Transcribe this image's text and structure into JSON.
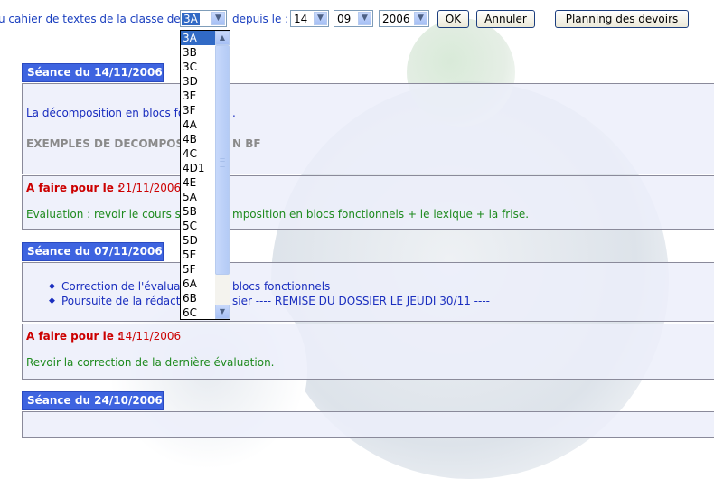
{
  "toolbar": {
    "intro_text": "u cahier de textes de la classe de",
    "class_value": "3A",
    "since_label": "depuis le :",
    "day_value": "14",
    "month_value": "09",
    "year_value": "2006",
    "ok_label": "OK",
    "cancel_label": "Annuler",
    "planning_label": "Planning des devoirs"
  },
  "dropdown": {
    "options": [
      "3A",
      "3B",
      "3C",
      "3D",
      "3E",
      "3F",
      "4A",
      "4B",
      "4C",
      "4D1",
      "4E",
      "5A",
      "5B",
      "5C",
      "5D",
      "5E",
      "5F",
      "6A",
      "6B",
      "6C"
    ],
    "selected": "3A"
  },
  "sessions": [
    {
      "title": "Séance du 14/11/2006",
      "line1": "La décomposition en blocs fo",
      "line1_tail": ".",
      "line2": "EXEMPLES DE DECOMPOS",
      "line2_tail": "N BF",
      "todo_label": "A faire pour le :",
      "todo_date": "21/11/2006",
      "todo_text_a": "Evaluation : revoir le cours su",
      "todo_text_b": "mposition en blocs fonctionnels + le lexique + la frise."
    },
    {
      "title": "Séance du 07/11/2006",
      "bullet1_a": "Correction de l'évaluati",
      "bullet1_b": "blocs fonctionnels",
      "bullet2_a": "Poursuite de la rédacti",
      "bullet2_b": "sier ---- REMISE DU DOSSIER LE JEUDI 30/11 ----",
      "todo_label": "A faire pour le :",
      "todo_date": "14/11/2006",
      "todo_text": "Revoir la correction de la dernière évaluation."
    },
    {
      "title": "Séance du 24/10/2006"
    }
  ],
  "colors": {
    "header_blue": "#3e64e0",
    "link_blue": "#1a2ebf",
    "red": "#cc0000",
    "green": "#1e8a1e",
    "selection": "#316ac5"
  }
}
